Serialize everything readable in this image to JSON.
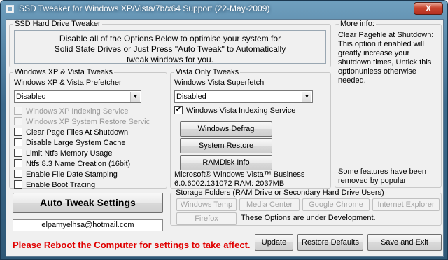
{
  "window": {
    "title": "SSD Tweaker for Windows XP/Vista/7b/x64 Support (22-May-2009)",
    "close_glyph": "X"
  },
  "hard_drive_group": {
    "legend": "SSD Hard Drive Tweaker",
    "description": "Disable all of the Options Below to optimise your system for Solid State Drives or Just Press \"Auto Tweak\" to Automatically tweak windows for you."
  },
  "xp_vista_group": {
    "legend": "Windows XP & Vista Tweaks",
    "prefetcher_label": "Windows XP & Vista Prefetcher",
    "prefetcher_value": "Disabled",
    "checkboxes": [
      {
        "label": "Windows XP Indexing Service",
        "checked": false,
        "enabled": false
      },
      {
        "label": "Windows XP System Restore Servic",
        "checked": false,
        "enabled": false
      },
      {
        "label": "Clear Page Files At Shutdown",
        "checked": false,
        "enabled": true
      },
      {
        "label": "Disable Large System Cache",
        "checked": false,
        "enabled": true
      },
      {
        "label": "Limit Ntfs Memory Usage",
        "checked": false,
        "enabled": true
      },
      {
        "label": "Ntfs 8.3 Name Creation (16bit)",
        "checked": false,
        "enabled": true
      },
      {
        "label": "Enable File Date Stamping",
        "checked": false,
        "enabled": true
      },
      {
        "label": "Enable Boot Tracing",
        "checked": false,
        "enabled": true
      }
    ]
  },
  "vista_group": {
    "legend": "Vista Only Tweaks",
    "superfetch_label": "Windows Vista Superfetch",
    "superfetch_value": "Disabled",
    "indexing_checkbox": {
      "label": "Windows Vista Indexing Service",
      "checked": true
    },
    "buttons": {
      "defrag": "Windows Defrag",
      "restore": "System Restore",
      "ramdisk": "RAMDisk Info"
    },
    "os_name": "Microsoft® Windows Vista™ Business",
    "os_build": "6.0.6002.131072 RAM: 2037MB"
  },
  "more_info": {
    "legend": "More info:",
    "text": "Clear Pagefile at Shutdown: This option if enabled will greatly increase your shutdown times, Untick this optionunless otherwise needed.",
    "note": "Some features have been removed by popular"
  },
  "auto_tweak_label": "Auto Tweak Settings",
  "email": "elpamyelhsa@hotmail.com",
  "storage_group": {
    "legend": "Storage Folders (RAM Drive or Secondary Hard Drive Users)",
    "buttons": [
      "Windows Temp",
      "Media Center",
      "Google Chrome",
      "Internet Explorer",
      "Firefox"
    ],
    "note": "These Options are under Development."
  },
  "footer": {
    "reboot_message": "Please Reboot the Computer for settings to take affect.",
    "update": "Update",
    "restore_defaults": "Restore Defaults",
    "save_exit": "Save and Exit"
  },
  "colors": {
    "title_gradient_top": "#6f9fbe",
    "client_background": "#f0f0f0",
    "reboot_text": "#e00000",
    "close_button": "#c8452e"
  },
  "icons": {
    "app": "app-icon",
    "close": "close-icon",
    "dropdown": "chevron-down-icon",
    "check": "checkmark-icon"
  }
}
